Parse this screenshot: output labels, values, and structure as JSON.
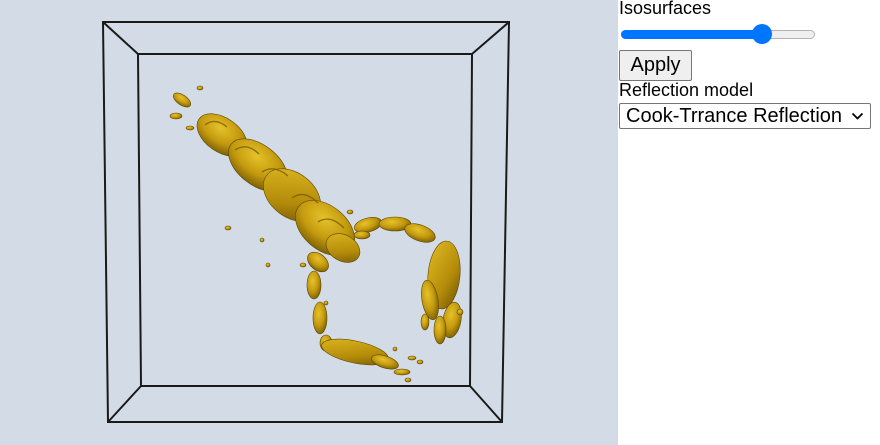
{
  "viewport": {
    "background_color": "#d3dce6",
    "frame_color": "#1a1a1a",
    "model_color": "#c9a210"
  },
  "controls": {
    "isosurfaces_label": "Isosurfaces",
    "slider_value_fraction": 0.75,
    "slider_accent_color": "#0075ff",
    "apply_label": "Apply",
    "reflection_label": "Reflection model",
    "reflection_selected": "Cook-Trrance Reflection"
  }
}
